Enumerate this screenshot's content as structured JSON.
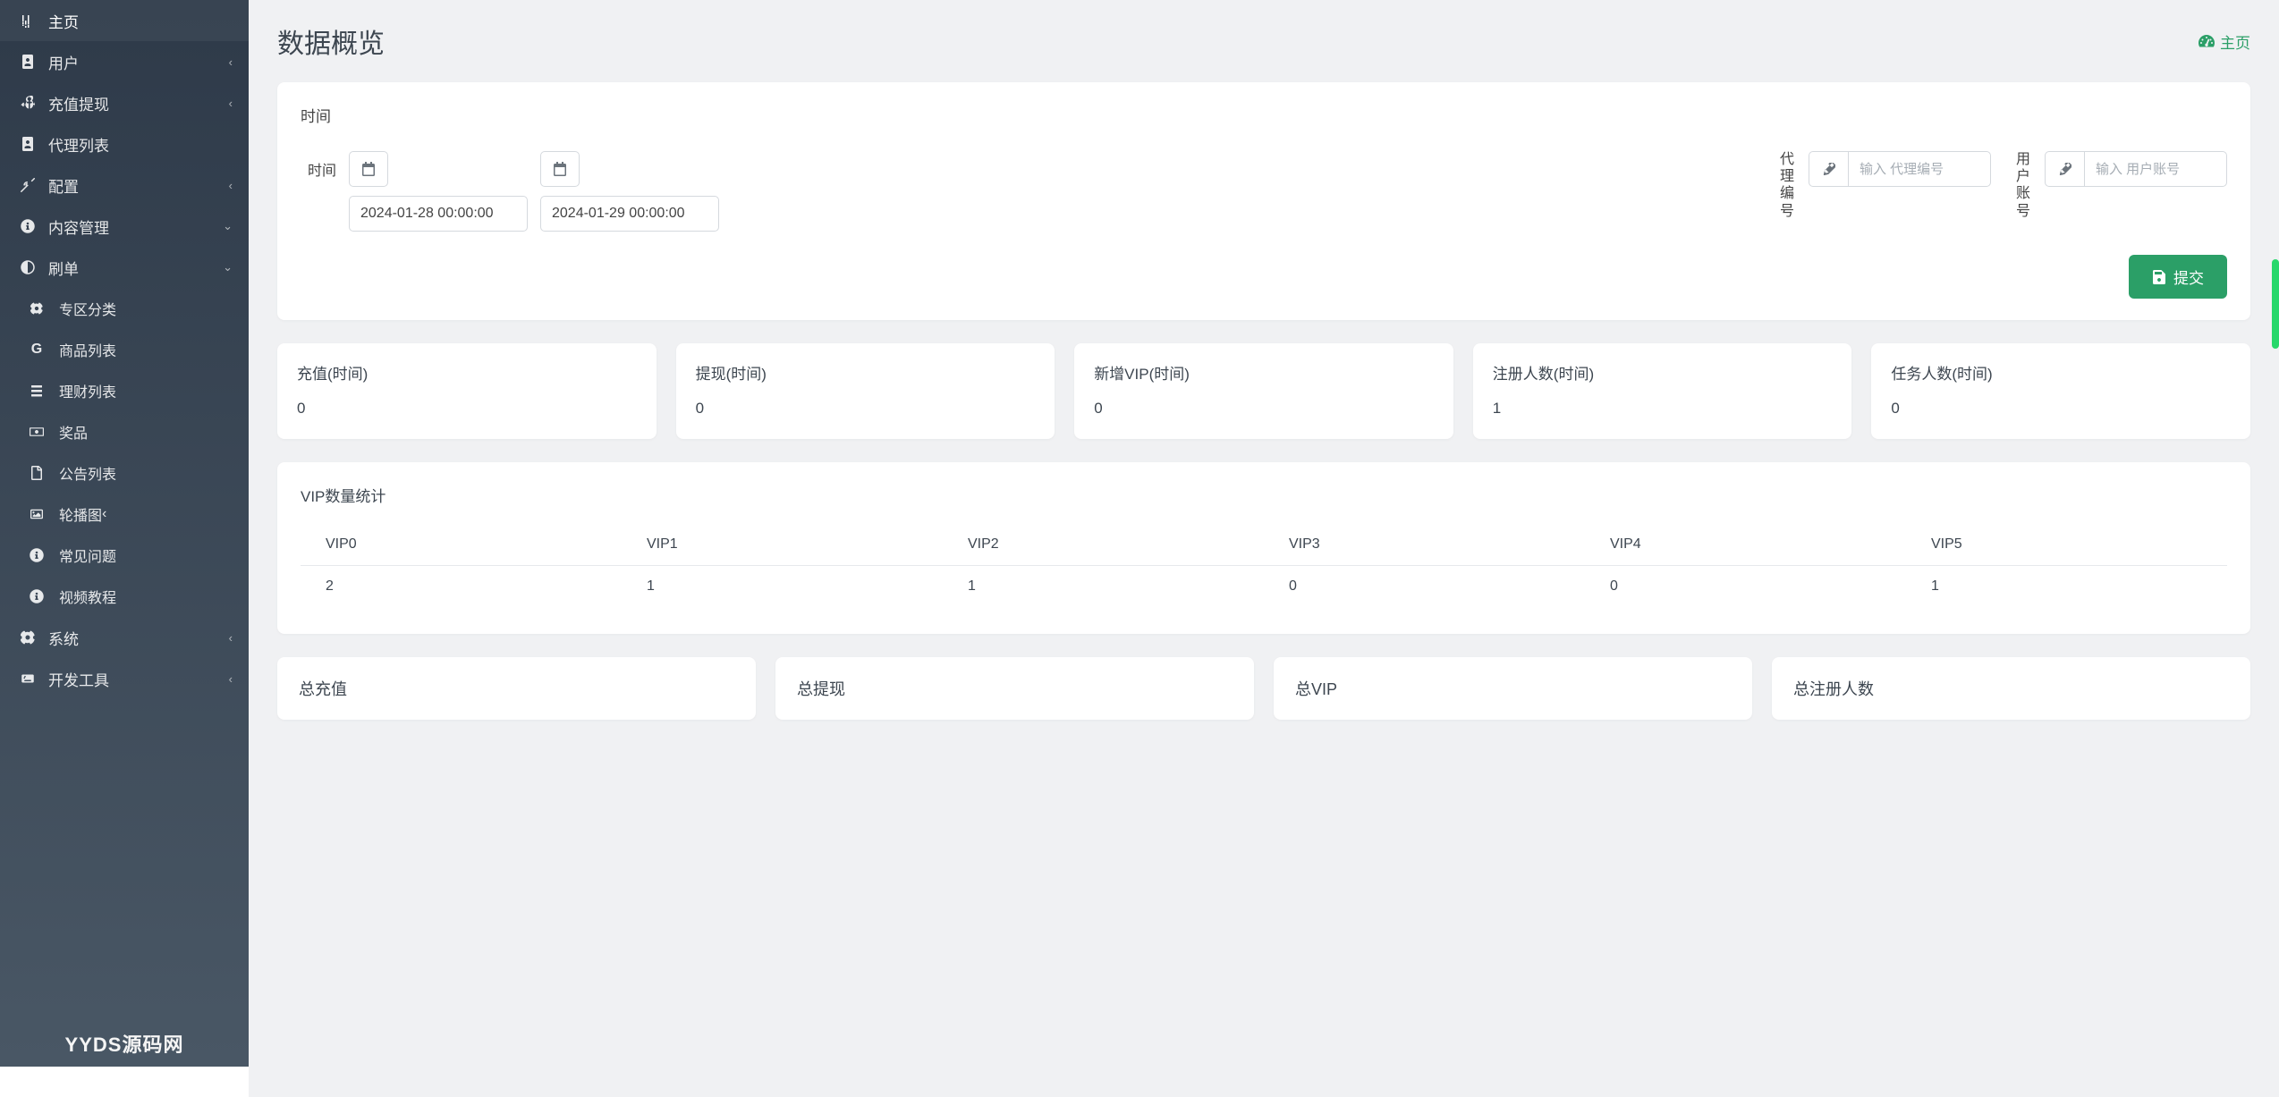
{
  "sidebar": {
    "items": [
      {
        "label": "主页",
        "icon": "bars",
        "active": true,
        "expandable": false
      },
      {
        "label": "用户",
        "icon": "id",
        "expandable": true,
        "chev": "left"
      },
      {
        "label": "充值提现",
        "icon": "anchor",
        "expandable": true,
        "chev": "left"
      },
      {
        "label": "代理列表",
        "icon": "id",
        "expandable": false
      },
      {
        "label": "配置",
        "icon": "deaf",
        "expandable": true,
        "chev": "left"
      },
      {
        "label": "内容管理",
        "icon": "question",
        "expandable": true,
        "chev": "down"
      },
      {
        "label": "刷单",
        "icon": "contrast",
        "expandable": true,
        "chev": "down"
      }
    ],
    "sub": [
      {
        "label": "专区分类",
        "icon": "gear"
      },
      {
        "label": "商品列表",
        "icon": "g"
      },
      {
        "label": "理财列表",
        "icon": "list"
      },
      {
        "label": "奖品",
        "icon": "money"
      },
      {
        "label": "公告列表",
        "icon": "file"
      },
      {
        "label": "轮播图",
        "icon": "image",
        "expandable": true,
        "chev": "left"
      },
      {
        "label": "常见问题",
        "icon": "question"
      },
      {
        "label": "视频教程",
        "icon": "question"
      }
    ],
    "tail": [
      {
        "label": "系统",
        "icon": "cog",
        "expandable": true,
        "chev": "left"
      },
      {
        "label": "开发工具",
        "icon": "keyboard",
        "expandable": true,
        "chev": "left"
      }
    ],
    "watermark": "YYDS源码网"
  },
  "page": {
    "title": "数据概览",
    "breadcrumb": "主页"
  },
  "filter": {
    "section_title": "时间",
    "time_label": "时间",
    "date_start": "2024-01-28 00:00:00",
    "date_end": "2024-01-29 00:00:00",
    "agent_label": "代理编号",
    "agent_placeholder": "输入 代理编号",
    "user_label": "用户账号",
    "user_placeholder": "输入 用户账号",
    "submit": "提交"
  },
  "stats": [
    {
      "title": "充值(时间)",
      "value": "0"
    },
    {
      "title": "提现(时间)",
      "value": "0"
    },
    {
      "title": "新增VIP(时间)",
      "value": "0"
    },
    {
      "title": "注册人数(时间)",
      "value": "1"
    },
    {
      "title": "任务人数(时间)",
      "value": "0"
    }
  ],
  "vip": {
    "title": "VIP数量统计",
    "headers": [
      "VIP0",
      "VIP1",
      "VIP2",
      "VIP3",
      "VIP4",
      "VIP5"
    ],
    "values": [
      "2",
      "1",
      "1",
      "0",
      "0",
      "1"
    ]
  },
  "summary": [
    {
      "title": "总充值"
    },
    {
      "title": "总提现"
    },
    {
      "title": "总VIP"
    },
    {
      "title": "总注册人数"
    }
  ]
}
